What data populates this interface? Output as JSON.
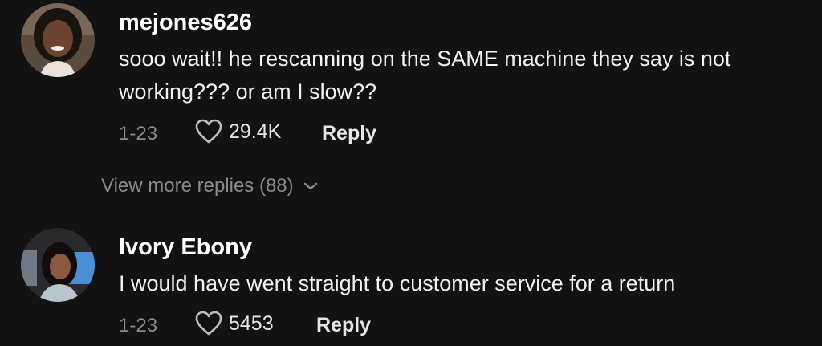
{
  "comments": [
    {
      "username": "mejones626",
      "text": "sooo wait!! he rescanning on the SAME machine they say is not working??? or am I slow??",
      "date": "1-23",
      "likes": "29.4K",
      "reply_label": "Reply",
      "view_more_label": "View more replies (88)"
    },
    {
      "username": "Ivory Ebony",
      "text": "I would have went straight to customer service for a return",
      "date": "1-23",
      "likes": "5453",
      "reply_label": "Reply"
    }
  ],
  "icons": {
    "like": "heart-outline-icon",
    "expand": "chevron-down-icon"
  },
  "colors": {
    "background": "#121212",
    "primary_text": "#ffffff",
    "secondary_text": "#8a8a8a"
  }
}
